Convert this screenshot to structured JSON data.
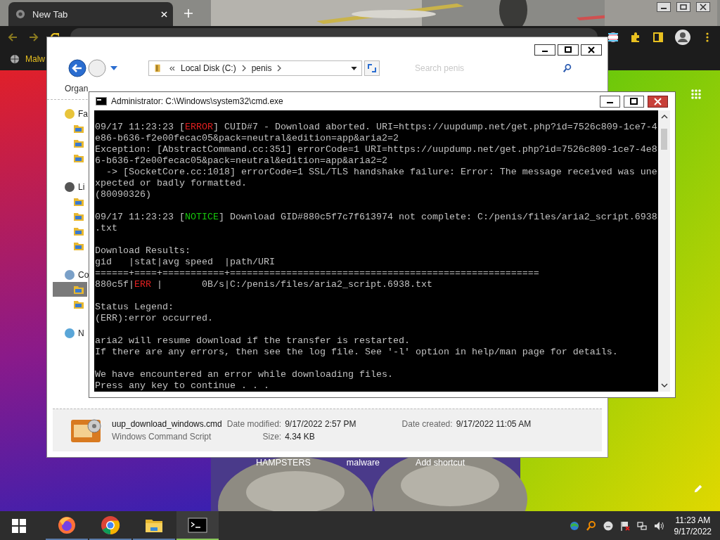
{
  "browser": {
    "tab": {
      "title": "New Tab",
      "selected": true
    },
    "bookmarks": [
      {
        "label": "Malw"
      }
    ],
    "shortcuts": [
      {
        "label": "HAMPSTERS"
      },
      {
        "label": "malware"
      },
      {
        "label": "Add shortcut"
      }
    ]
  },
  "explorer": {
    "breadcrumb": [
      "Local Disk (C:)",
      "penis"
    ],
    "search": {
      "placeholder": "Search penis"
    },
    "toolbar": {
      "label": "Organ"
    },
    "nav": [
      {
        "label": "Fa",
        "kind": "favorites",
        "children": [
          {
            "selected": false
          },
          {
            "selected": false
          },
          {
            "selected": false
          }
        ]
      },
      {
        "label": "Li",
        "kind": "libraries",
        "children": [
          {
            "selected": false
          },
          {
            "selected": false
          },
          {
            "selected": false
          },
          {
            "selected": false
          }
        ]
      },
      {
        "label": "Co",
        "kind": "computer",
        "children": [
          {
            "selected": true
          },
          {
            "selected": false
          }
        ]
      },
      {
        "label": "N",
        "kind": "network"
      }
    ],
    "details": {
      "name": "uup_download_windows.cmd",
      "type": "Windows Command Script",
      "fields": [
        {
          "label": "Date modified:",
          "value": "9/17/2022 2:57 PM"
        },
        {
          "label": "Size:",
          "value": "4.34 KB"
        },
        {
          "label": "Date created:",
          "value": "9/17/2022 11:05 AM"
        }
      ]
    }
  },
  "console": {
    "title": "Administrator: C:\\Windows\\system32\\cmd.exe",
    "blocks": [
      [
        [
          {
            "text": "09/17 11:23:23 [",
            "kind": "plain"
          },
          {
            "text": "ERROR",
            "kind": "error"
          },
          {
            "text": "] CUID#7 - Download aborted. URI=https://uupdump.net/get.php?id=7526c809-1ce7-4",
            "kind": "plain"
          }
        ],
        [
          {
            "text": "e86-b636-f2e00fecac05&pack=neutral&edition=app&aria2=2",
            "kind": "plain"
          }
        ],
        [
          {
            "text": "Exception: [AbstractCommand.cc:351] errorCode=1 URI=https://uupdump.net/get.php?id=7526c809-1ce7-4e8",
            "kind": "plain"
          }
        ],
        [
          {
            "text": "6-b636-f2e00fecac05&pack=neutral&edition=app&aria2=2",
            "kind": "plain"
          }
        ],
        [
          {
            "text": "  -> [SocketCore.cc:1018] errorCode=1 SSL/TLS handshake failure: Error: The message received was une",
            "kind": "plain"
          }
        ],
        [
          {
            "text": "xpected or badly formatted.",
            "kind": "plain"
          }
        ],
        [
          {
            "text": "(80090326)",
            "kind": "plain"
          }
        ]
      ],
      [
        [
          {
            "text": "09/17 11:23:23 [",
            "kind": "plain"
          },
          {
            "text": "NOTICE",
            "kind": "notice"
          },
          {
            "text": "] Download GID#880c5f7c7f613974 not complete: C:/penis/files/aria2_script.6938",
            "kind": "plain"
          }
        ],
        [
          {
            "text": ".txt",
            "kind": "plain"
          }
        ]
      ],
      [
        [
          {
            "text": "Download Results:",
            "kind": "plain"
          }
        ],
        [
          {
            "text": "gid   |stat|avg speed  |path/URI",
            "kind": "plain"
          }
        ],
        [
          {
            "text": "======+====+===========+=======================================================",
            "kind": "plain"
          }
        ],
        [
          {
            "text": "880c5f|",
            "kind": "plain"
          },
          {
            "text": "ERR",
            "kind": "error"
          },
          {
            "text": " |       0B/s|C:/penis/files/aria2_script.6938.txt",
            "kind": "plain"
          }
        ]
      ],
      [
        [
          {
            "text": "Status Legend:",
            "kind": "plain"
          }
        ],
        [
          {
            "text": "(ERR):error occurred.",
            "kind": "plain"
          }
        ]
      ],
      [
        [
          {
            "text": "aria2 will resume download if the transfer is restarted.",
            "kind": "plain"
          }
        ],
        [
          {
            "text": "If there are any errors, then see the log file. See '-l' option in help/man page for details.",
            "kind": "plain"
          }
        ]
      ],
      [
        [
          {
            "text": "We have encountered an error while downloading files.",
            "kind": "plain"
          }
        ],
        [
          {
            "text": "Press any key to continue . . .",
            "kind": "plain"
          }
        ]
      ]
    ]
  },
  "taskbar": {
    "apps": [
      {
        "kind": "firefox",
        "active": false
      },
      {
        "kind": "chrome",
        "active": false
      },
      {
        "kind": "folder",
        "active": false
      },
      {
        "kind": "terminal",
        "active": true
      }
    ],
    "time": "11:23 AM",
    "date": "9/17/2022"
  }
}
